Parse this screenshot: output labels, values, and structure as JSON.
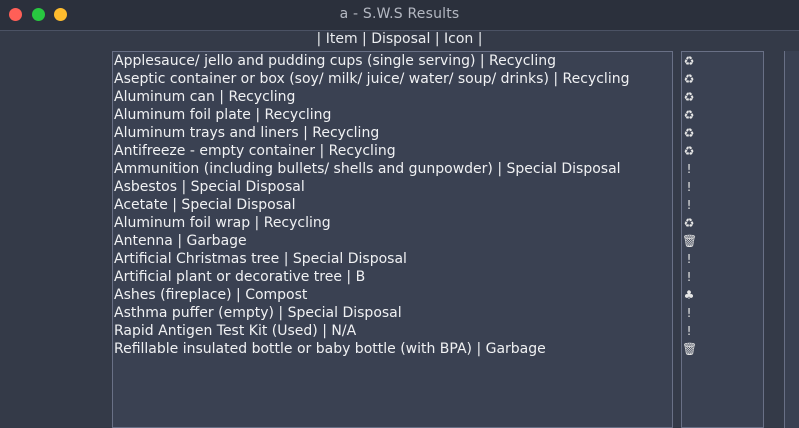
{
  "window": {
    "title": "a - S.W.S Results",
    "controls": {
      "close": "#ff5f57",
      "minimize": "#28c840",
      "maximize": "#febc2e"
    }
  },
  "header": {
    "text": "| Item | Disposal | Icon |"
  },
  "items": [
    {
      "label": "Applesauce/ jello and pudding cups (single serving) | Recycling",
      "icon": "♻"
    },
    {
      "label": "Aseptic container or box (soy/ milk/ juice/ water/ soup/ drinks) | Recycling",
      "icon": "♻"
    },
    {
      "label": "Aluminum can | Recycling",
      "icon": "♻"
    },
    {
      "label": "Aluminum foil plate | Recycling",
      "icon": "♻"
    },
    {
      "label": "Aluminum trays and liners | Recycling",
      "icon": "♻"
    },
    {
      "label": "Antifreeze - empty container | Recycling",
      "icon": "♻"
    },
    {
      "label": "Ammunition (including bullets/ shells and gunpowder) | Special Disposal",
      "icon": "!"
    },
    {
      "label": "Asbestos | Special Disposal",
      "icon": "!"
    },
    {
      "label": "Acetate | Special Disposal",
      "icon": "!"
    },
    {
      "label": "Aluminum foil wrap | Recycling",
      "icon": "♻"
    },
    {
      "label": "Antenna | Garbage",
      "icon": "🗑"
    },
    {
      "label": "Artificial Christmas tree | Special Disposal",
      "icon": "!"
    },
    {
      "label": "Artificial plant or decorative tree | B",
      "icon": "!"
    },
    {
      "label": "Ashes (fireplace) | Compost",
      "icon": "♣"
    },
    {
      "label": "Asthma puffer (empty) | Special Disposal",
      "icon": "!"
    },
    {
      "label": "Rapid Antigen Test Kit (Used) | N/A",
      "icon": "!"
    },
    {
      "label": "Refillable insulated bottle or baby bottle (with BPA) | Garbage",
      "icon": "🗑"
    }
  ]
}
